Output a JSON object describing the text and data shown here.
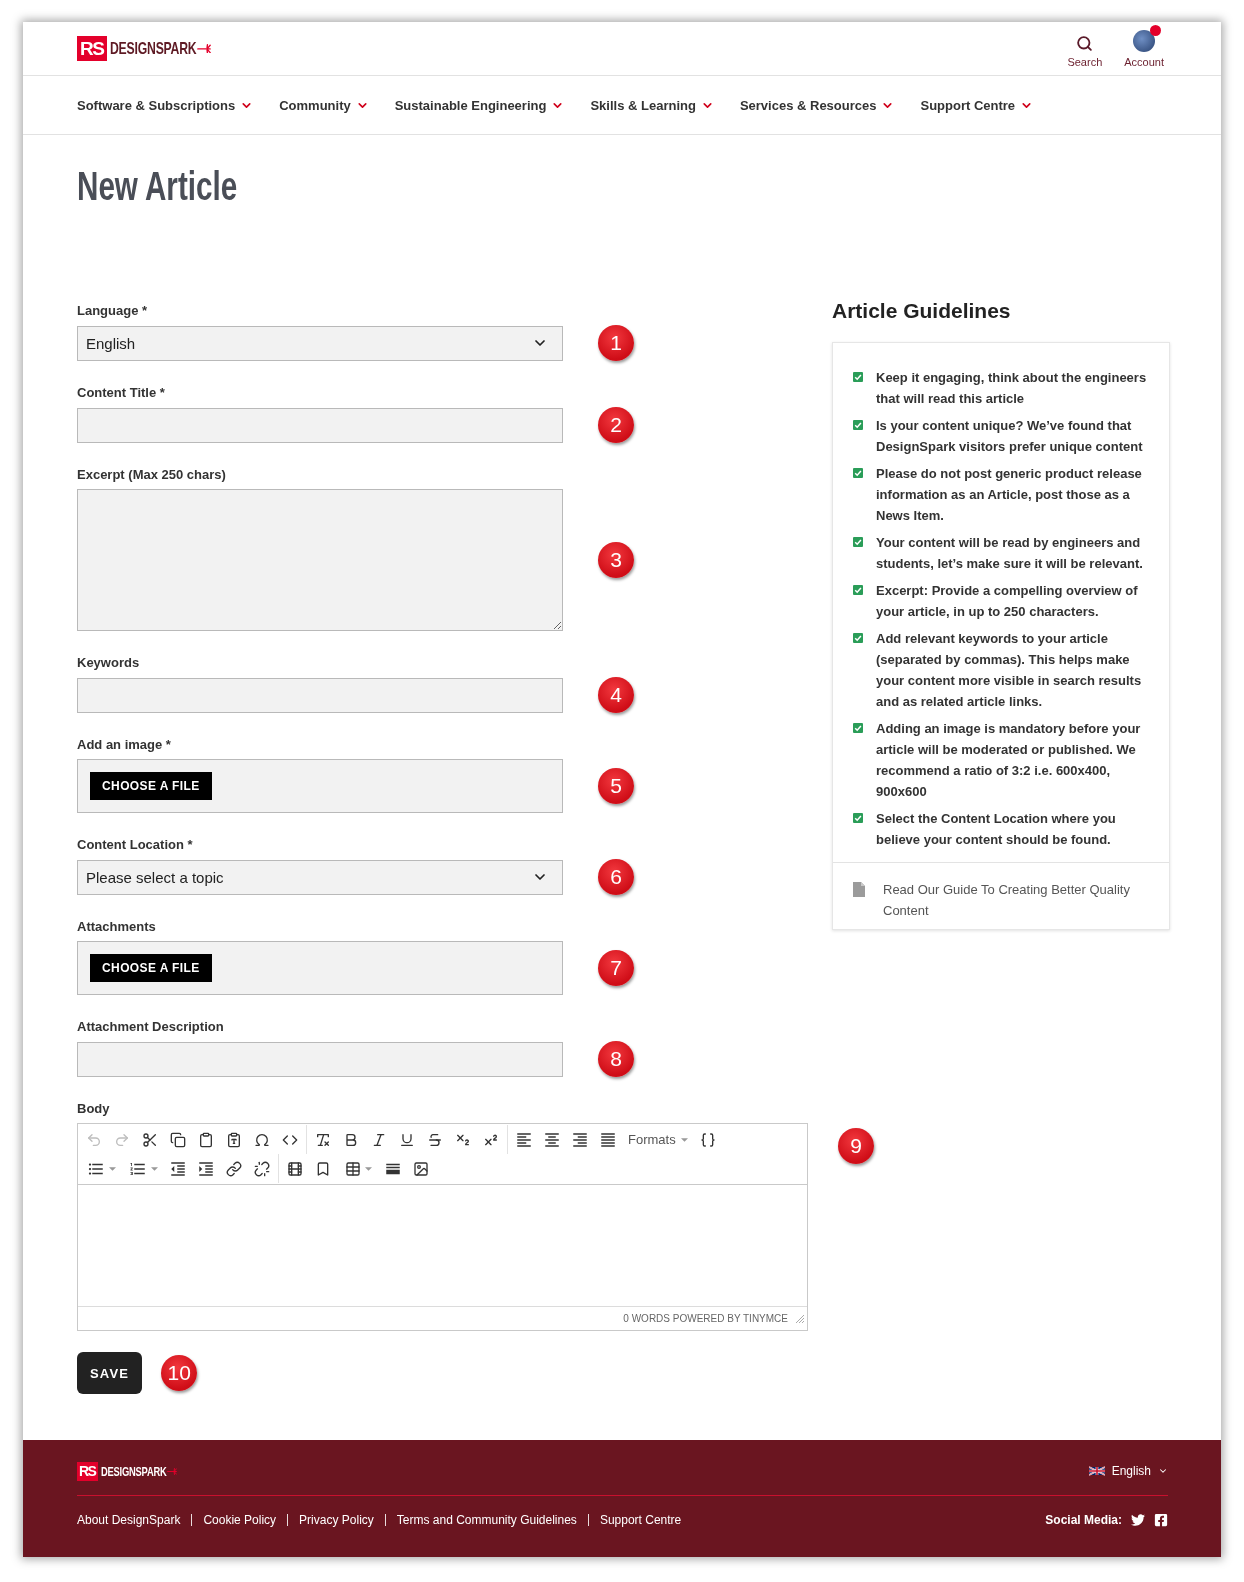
{
  "header": {
    "logo": {
      "badge": "RS",
      "wordmark": "DESIGNSPARK"
    },
    "actions": [
      {
        "kind": "search",
        "label": "Search",
        "notification": false
      },
      {
        "kind": "account",
        "label": "Account",
        "notification": true
      }
    ]
  },
  "nav": [
    {
      "label": "Software & Subscriptions"
    },
    {
      "label": "Community"
    },
    {
      "label": "Sustainable Engineering"
    },
    {
      "label": "Skills & Learning"
    },
    {
      "label": "Services & Resources"
    },
    {
      "label": "Support Centre"
    }
  ],
  "page_title": "New Article",
  "form": {
    "fields": [
      {
        "kind": "select",
        "label": "Language *",
        "value": "English",
        "marker": "1"
      },
      {
        "kind": "text",
        "label": "Content Title *",
        "marker": "2"
      },
      {
        "kind": "textarea",
        "label": "Excerpt (Max 250 chars)",
        "marker": "3"
      },
      {
        "kind": "text",
        "label": "Keywords",
        "marker": "4"
      },
      {
        "kind": "file",
        "label": "Add an image *",
        "button": "CHOOSE A FILE",
        "marker": "5"
      },
      {
        "kind": "select",
        "label": "Content Location *",
        "value": "Please select a topic",
        "marker": "6"
      },
      {
        "kind": "file",
        "label": "Attachments",
        "button": "CHOOSE A FILE",
        "marker": "7"
      },
      {
        "kind": "text",
        "label": "Attachment Description",
        "marker": "8"
      }
    ]
  },
  "guidelines": {
    "title": "Article Guidelines",
    "items": [
      {
        "text": "Keep it engaging, think about the engineers that will read this article",
        "checked": true
      },
      {
        "text": "Is your content unique? We’ve found that DesignSpark visitors prefer unique content",
        "checked": true
      },
      {
        "text": "Please do not post generic product release information as an Article, post those as a News Item.",
        "checked": true
      },
      {
        "text": "Your content will be read by engineers and students, let’s make sure it will be relevant.",
        "checked": true
      },
      {
        "text": "Excerpt: Provide a compelling overview of your article, in up to 250 characters.",
        "checked": true
      },
      {
        "text": "Add relevant keywords to your article (separated by commas). This helps make your content more visible in search results and as related article links.",
        "checked": true
      },
      {
        "text": "Adding an image is mandatory before your article will be moderated or published. We recommend a ratio of 3:2 i.e. 600x400, 900x600",
        "checked": true
      },
      {
        "text": "Select the Content Location where you believe your content should be found.",
        "checked": true
      }
    ],
    "guide_link": "Read Our Guide To Creating Better Quality Content"
  },
  "body_editor": {
    "label": "Body",
    "marker": "9",
    "toolbar_rows": [
      {
        "groups": [
          {
            "tools": [
              {
                "kind": "undo",
                "disabled": true
              },
              {
                "kind": "redo",
                "disabled": true
              },
              {
                "kind": "cut",
                "disabled": false
              },
              {
                "kind": "copy",
                "disabled": false
              },
              {
                "kind": "paste",
                "disabled": false
              },
              {
                "kind": "paste-text",
                "disabled": false
              },
              {
                "kind": "special-character",
                "disabled": false
              },
              {
                "kind": "source-code",
                "disabled": false
              }
            ]
          },
          {
            "tools": [
              {
                "kind": "clear-formatting",
                "disabled": false
              },
              {
                "kind": "bold",
                "disabled": false
              },
              {
                "kind": "italic",
                "disabled": false
              },
              {
                "kind": "underline",
                "disabled": false
              },
              {
                "kind": "strikethrough",
                "disabled": false
              },
              {
                "kind": "subscript",
                "disabled": false
              },
              {
                "kind": "superscript",
                "disabled": false
              }
            ]
          },
          {
            "tools": [
              {
                "kind": "align-left",
                "disabled": false
              },
              {
                "kind": "align-center",
                "disabled": false
              },
              {
                "kind": "align-right",
                "disabled": false
              },
              {
                "kind": "justify",
                "disabled": false
              },
              {
                "kind": "formats",
                "label": "Formats",
                "disabled": false
              },
              {
                "kind": "template",
                "disabled": false
              }
            ]
          }
        ]
      },
      {
        "groups": [
          {
            "tools": [
              {
                "kind": "bullet-list",
                "disabled": false
              },
              {
                "kind": "numbered-list",
                "disabled": false
              },
              {
                "kind": "outdent",
                "disabled": false
              },
              {
                "kind": "indent",
                "disabled": false
              },
              {
                "kind": "link",
                "disabled": false
              },
              {
                "kind": "unlink",
                "disabled": false
              }
            ]
          },
          {
            "tools": [
              {
                "kind": "media",
                "disabled": false
              },
              {
                "kind": "anchor",
                "disabled": false
              },
              {
                "kind": "table",
                "disabled": false
              },
              {
                "kind": "page-break",
                "disabled": false
              },
              {
                "kind": "image",
                "disabled": false
              }
            ]
          }
        ]
      }
    ],
    "status": "0 WORDS POWERED BY TINYMCE"
  },
  "save_button": {
    "label": "SAVE",
    "marker": "10"
  },
  "footer": {
    "logo": {
      "badge": "RS",
      "wordmark": "DESIGNSPARK"
    },
    "language": "English",
    "links": [
      "About DesignSpark",
      "Cookie Policy",
      "Privacy Policy",
      "Terms and Community Guidelines",
      "Support Centre"
    ],
    "social_label": "Social Media:",
    "social": [
      {
        "kind": "twitter"
      },
      {
        "kind": "facebook"
      }
    ]
  }
}
